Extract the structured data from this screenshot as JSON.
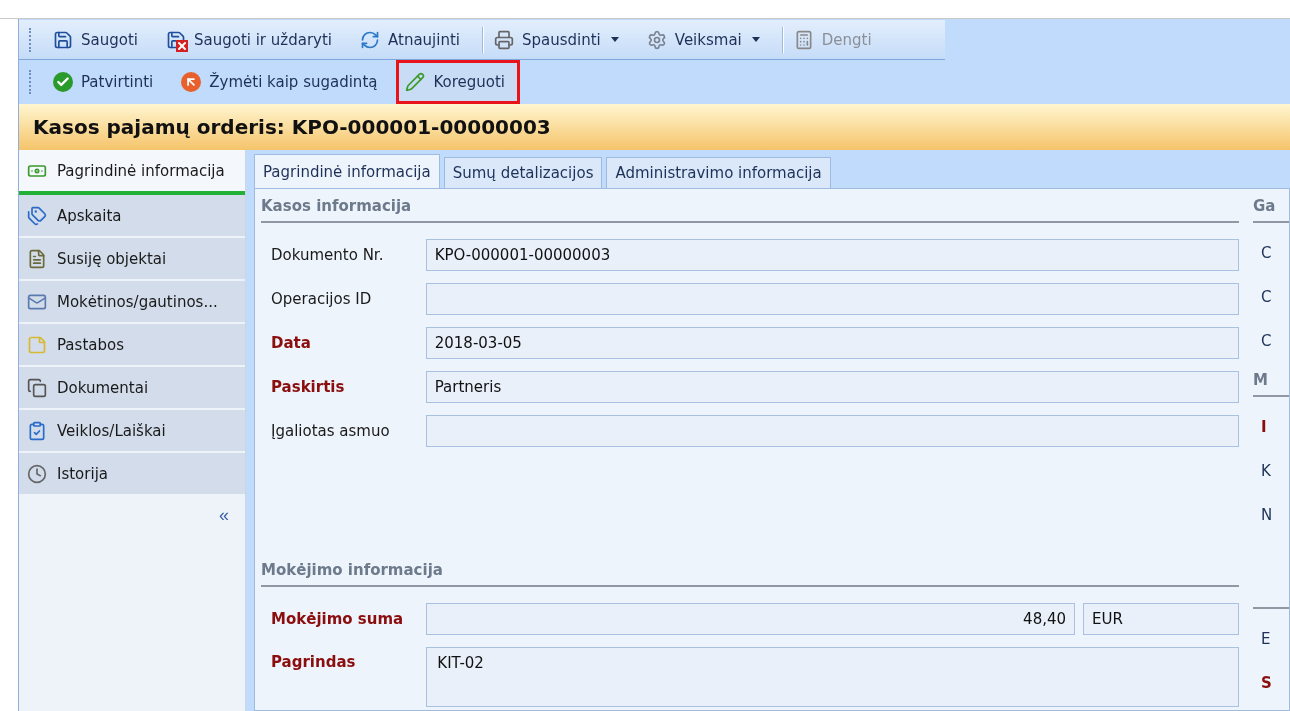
{
  "toolbar_main": [
    {
      "label": "Saugoti",
      "has_menu": false,
      "disabled": false,
      "separator_before": false
    },
    {
      "label": "Saugoti ir uždaryti",
      "has_menu": false,
      "disabled": false,
      "separator_before": false
    },
    {
      "label": "Atnaujinti",
      "has_menu": false,
      "disabled": false,
      "separator_before": false
    },
    {
      "label": "Spausdinti",
      "has_menu": true,
      "disabled": false,
      "separator_before": true
    },
    {
      "label": "Veiksmai",
      "has_menu": true,
      "disabled": false,
      "separator_before": false
    },
    {
      "label": "Dengti",
      "has_menu": false,
      "disabled": true,
      "separator_before": true
    }
  ],
  "toolbar_actions": [
    {
      "label": "Patvirtinti",
      "highlighted": false
    },
    {
      "label": "Žymėti kaip sugadintą",
      "highlighted": false
    },
    {
      "label": "Koreguoti",
      "highlighted": true
    }
  ],
  "document_title": "Kasos pajamų orderis: KPO-000001-00000003",
  "sidebar": {
    "items": [
      {
        "label": "Pagrindinė informacija",
        "selected": true
      },
      {
        "label": "Apskaita",
        "selected": false
      },
      {
        "label": "Susiję objektai",
        "selected": false
      },
      {
        "label": "Mokėtinos/gautinos...",
        "selected": false
      },
      {
        "label": "Pastabos",
        "selected": false
      },
      {
        "label": "Dokumentai",
        "selected": false
      },
      {
        "label": "Veiklos/Laiškai",
        "selected": false
      },
      {
        "label": "Istorija",
        "selected": false
      }
    ],
    "collapse": "«"
  },
  "tabs": [
    {
      "label": "Pagrindinė informacija",
      "selected": true
    },
    {
      "label": "Sumų detalizacijos",
      "selected": false
    },
    {
      "label": "Administravimo informacija",
      "selected": false
    }
  ],
  "cash_section": {
    "heading": "Kasos informacija",
    "fields": [
      {
        "label": "Dokumento Nr.",
        "value": "KPO-000001-00000003",
        "required": false
      },
      {
        "label": "Operacijos ID",
        "required": false
      },
      {
        "label": "Data",
        "value": "2018-03-05",
        "required": true
      },
      {
        "label": "Paskirtis",
        "value": "Partneris",
        "required": true
      },
      {
        "label": "Įgaliotas asmuo",
        "required": false
      }
    ]
  },
  "payment_section": {
    "heading": "Mokėjimo informacija",
    "amount": {
      "label": "Mokėjimo suma",
      "value": "48,40",
      "currency": "EUR",
      "required": true
    },
    "basis": {
      "label": "Pagrindas",
      "value": "KIT-02",
      "required": true
    }
  },
  "right_column": {
    "sections": [
      {
        "heading": "Ga",
        "labels": [
          {
            "text": "C",
            "required": false
          },
          {
            "text": "C",
            "required": false
          },
          {
            "text": "C",
            "required": false
          }
        ]
      },
      {
        "heading": "M",
        "labels": [
          {
            "text": "I",
            "required": true
          },
          {
            "text": "K",
            "required": false
          },
          {
            "text": "N",
            "required": false
          }
        ]
      },
      {
        "labels": [
          {
            "text": "E",
            "required": false
          },
          {
            "text": "S",
            "required": true
          }
        ]
      }
    ]
  }
}
